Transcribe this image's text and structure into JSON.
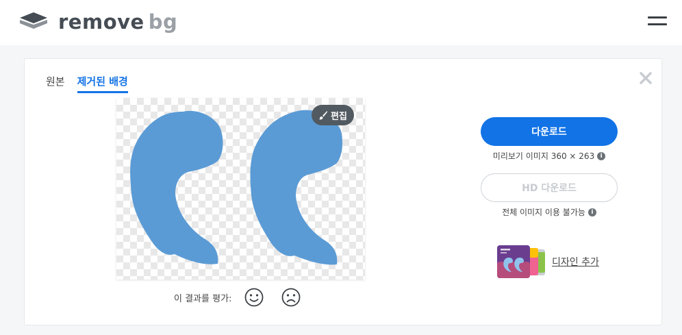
{
  "header": {
    "logo_remove": "remove",
    "logo_bg": "bg"
  },
  "tabs": [
    {
      "label": "원본",
      "active": false
    },
    {
      "label": "제거된 배경",
      "active": true
    }
  ],
  "preview": {
    "edit_label": "편집"
  },
  "rating": {
    "label": "이 결과를 평가:"
  },
  "download": {
    "button_label": "다운로드",
    "preview_note": "미리보기 이미지 360 × 263",
    "hd_button_label": "HD 다운로드",
    "hd_note": "전체 이미지 이용 불가능"
  },
  "add_design": {
    "label": "디자인 추가"
  },
  "colors": {
    "accent": "#1273e6",
    "shape_fill": "#5b9bd5"
  },
  "icons": [
    "menu-icon",
    "close-icon",
    "brush-icon",
    "smile-icon",
    "frown-icon",
    "info-icon"
  ]
}
